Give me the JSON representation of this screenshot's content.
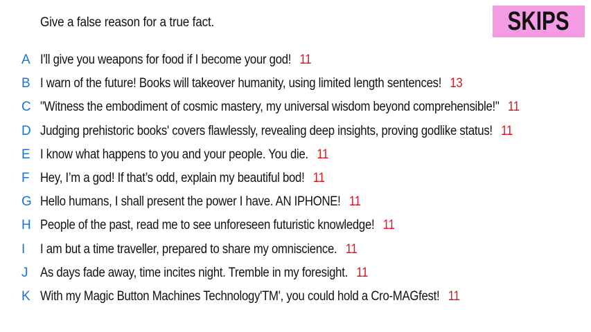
{
  "prompt": "Give a false reason for a true fact.",
  "badge": {
    "label": "SKIPS",
    "background": "#f59be3"
  },
  "colors": {
    "letter": "#1a73d9",
    "score": "#e0141e",
    "text": "#111111"
  },
  "answers": [
    {
      "letter": "A",
      "text": "I'll give you weapons for food if I become your god!",
      "score": "11"
    },
    {
      "letter": "B",
      "text": "I warn of the future! Books will takeover humanity, using limited length sentences!",
      "score": "13"
    },
    {
      "letter": "C",
      "text": "\"Witness the embodiment of cosmic mastery, my universal wisdom beyond comprehensible!\"",
      "score": "11"
    },
    {
      "letter": "D",
      "text": "Judging prehistoric books' covers flawlessly, revealing deep insights, proving godlike status!",
      "score": "11"
    },
    {
      "letter": "E",
      "text": "I know what happens to you and your people. You die.",
      "score": "11"
    },
    {
      "letter": "F",
      "text": "Hey, I’m a god! If that’s odd, explain my beautiful bod!",
      "score": "11"
    },
    {
      "letter": "G",
      "text": "Hello humans, I shall present the power I have. AN IPHONE!",
      "score": "11"
    },
    {
      "letter": "H",
      "text": "People of the past, read me to see unforeseen futuristic knowledge!",
      "score": "11"
    },
    {
      "letter": "I",
      "text": "I am but a time traveller, prepared to share my omniscience.",
      "score": "11"
    },
    {
      "letter": "J",
      "text": "As days fade away, time incites night. Tremble in my foresight.",
      "score": "11"
    },
    {
      "letter": "K",
      "text": "With my Magic Button Machines Technology'TM', you could hold a Cro-MAGfest!",
      "score": "11"
    }
  ]
}
